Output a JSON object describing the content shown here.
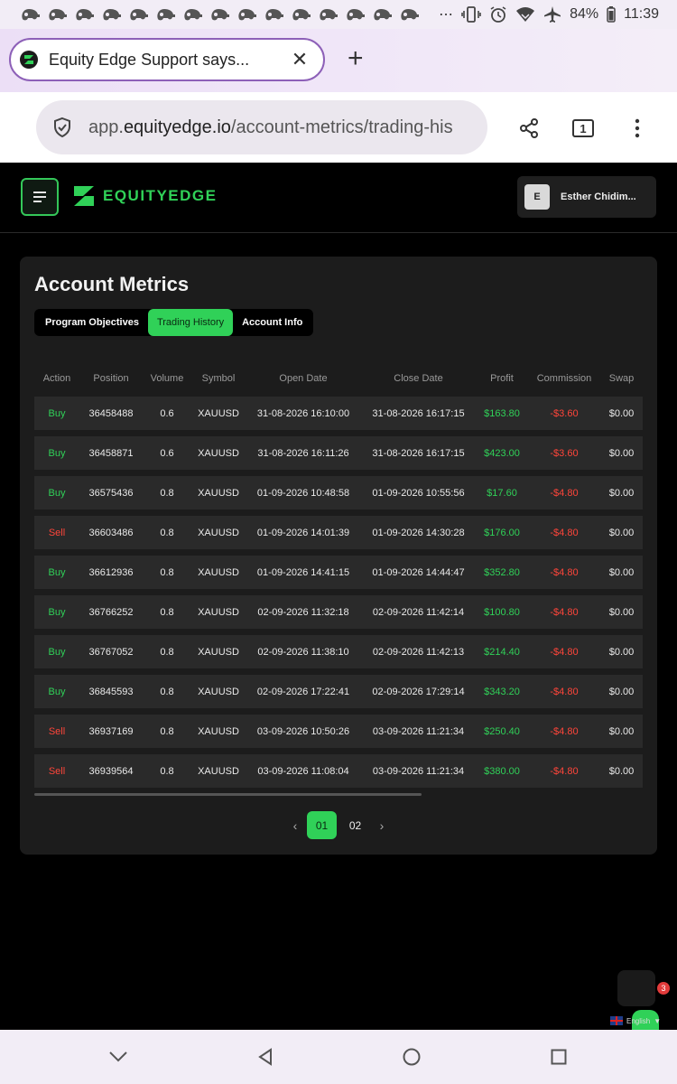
{
  "status_bar": {
    "battery": "84%",
    "time": "11:39",
    "notification_icon_count": 15
  },
  "browser": {
    "tab_title": "Equity Edge Support says...",
    "url_domain_prefix": "app.",
    "url_domain": "equityedge.io",
    "url_path": "/account-metrics/trading-his",
    "tab_count": "1"
  },
  "app": {
    "logo_text": "EQUITYEDGE",
    "user_initial": "E",
    "user_name": "Esther Chidim..."
  },
  "card": {
    "title": "Account Metrics",
    "tabs": [
      {
        "label": "Program Objectives",
        "active": false
      },
      {
        "label": "Trading History",
        "active": true
      },
      {
        "label": "Account Info",
        "active": false
      }
    ],
    "columns": [
      "Action",
      "Position",
      "Volume",
      "Symbol",
      "Open Date",
      "Close Date",
      "Profit",
      "Commission",
      "Swap"
    ],
    "rows": [
      {
        "action": "Buy",
        "position": "36458488",
        "volume": "0.6",
        "symbol": "XAUUSD",
        "open": "31-08-2026 16:10:00",
        "close": "31-08-2026 16:17:15",
        "profit": "$163.80",
        "commission": "-$3.60",
        "swap": "$0.00"
      },
      {
        "action": "Buy",
        "position": "36458871",
        "volume": "0.6",
        "symbol": "XAUUSD",
        "open": "31-08-2026 16:11:26",
        "close": "31-08-2026 16:17:15",
        "profit": "$423.00",
        "commission": "-$3.60",
        "swap": "$0.00"
      },
      {
        "action": "Buy",
        "position": "36575436",
        "volume": "0.8",
        "symbol": "XAUUSD",
        "open": "01-09-2026 10:48:58",
        "close": "01-09-2026 10:55:56",
        "profit": "$17.60",
        "commission": "-$4.80",
        "swap": "$0.00"
      },
      {
        "action": "Sell",
        "position": "36603486",
        "volume": "0.8",
        "symbol": "XAUUSD",
        "open": "01-09-2026 14:01:39",
        "close": "01-09-2026 14:30:28",
        "profit": "$176.00",
        "commission": "-$4.80",
        "swap": "$0.00"
      },
      {
        "action": "Buy",
        "position": "36612936",
        "volume": "0.8",
        "symbol": "XAUUSD",
        "open": "01-09-2026 14:41:15",
        "close": "01-09-2026 14:44:47",
        "profit": "$352.80",
        "commission": "-$4.80",
        "swap": "$0.00"
      },
      {
        "action": "Buy",
        "position": "36766252",
        "volume": "0.8",
        "symbol": "XAUUSD",
        "open": "02-09-2026 11:32:18",
        "close": "02-09-2026 11:42:14",
        "profit": "$100.80",
        "commission": "-$4.80",
        "swap": "$0.00"
      },
      {
        "action": "Buy",
        "position": "36767052",
        "volume": "0.8",
        "symbol": "XAUUSD",
        "open": "02-09-2026 11:38:10",
        "close": "02-09-2026 11:42:13",
        "profit": "$214.40",
        "commission": "-$4.80",
        "swap": "$0.00"
      },
      {
        "action": "Buy",
        "position": "36845593",
        "volume": "0.8",
        "symbol": "XAUUSD",
        "open": "02-09-2026 17:22:41",
        "close": "02-09-2026 17:29:14",
        "profit": "$343.20",
        "commission": "-$4.80",
        "swap": "$0.00"
      },
      {
        "action": "Sell",
        "position": "36937169",
        "volume": "0.8",
        "symbol": "XAUUSD",
        "open": "03-09-2026 10:50:26",
        "close": "03-09-2026 11:21:34",
        "profit": "$250.40",
        "commission": "-$4.80",
        "swap": "$0.00"
      },
      {
        "action": "Sell",
        "position": "36939564",
        "volume": "0.8",
        "symbol": "XAUUSD",
        "open": "03-09-2026 11:08:04",
        "close": "03-09-2026 11:21:34",
        "profit": "$380.00",
        "commission": "-$4.80",
        "swap": "$0.00"
      }
    ],
    "pagination": {
      "pages": [
        "01",
        "02"
      ],
      "current": "01"
    }
  },
  "widgets": {
    "chat_badge": "3",
    "language": "English"
  },
  "colors": {
    "accent": "#30d158",
    "sell": "#ff453a",
    "card_bg": "#1c1c1c",
    "row_bg": "#2a2a2a"
  },
  "icons": {
    "status": [
      "notification-app-icon",
      "more-dots-icon",
      "vibrate-icon",
      "alarm-icon",
      "wifi-icon",
      "airplane-icon"
    ],
    "browser": [
      "shield-icon",
      "share-icon",
      "tab-count-icon",
      "overflow-menu-icon"
    ],
    "nav": [
      "chevron-down-icon",
      "back-icon",
      "home-icon",
      "recents-icon"
    ]
  }
}
